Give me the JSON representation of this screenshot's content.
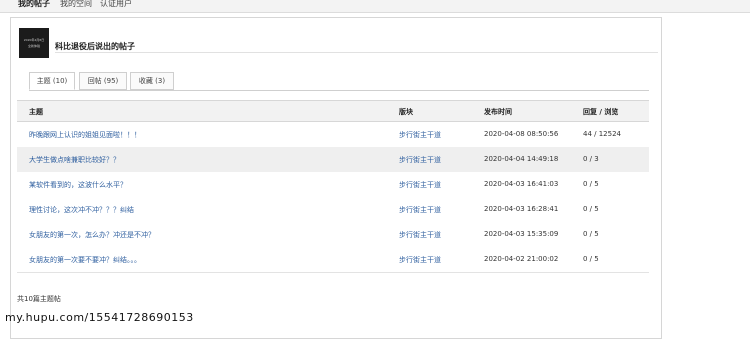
{
  "topnav": {
    "items": [
      "我的帖子",
      "我的空间",
      "认证用户"
    ]
  },
  "avatar": {
    "text_line1": "2020年4月8日",
    "text_line2": "全新体验"
  },
  "header": {
    "title": "科比退役后说出的帖子"
  },
  "tabs": [
    {
      "label": "主题 (10)"
    },
    {
      "label": "回帖 (95)"
    },
    {
      "label": "收藏 (3)"
    }
  ],
  "table": {
    "columns": [
      "主题",
      "版块",
      "发布时间",
      "回复 / 浏览"
    ],
    "rows": [
      {
        "subject": "昨晚跟网上认识的姐姐见面啦！！！",
        "forum": "步行街主干道",
        "time": "2020-04-08 08:50:56",
        "count": "44 / 12524"
      },
      {
        "subject": "大学生做点啥兼职比较好？？",
        "forum": "步行街主干道",
        "time": "2020-04-04 14:49:18",
        "count": "0 / 3"
      },
      {
        "subject": "某软件看到的，这波什么水平？",
        "forum": "步行街主干道",
        "time": "2020-04-03 16:41:03",
        "count": "0 / 5"
      },
      {
        "subject": "理性讨论，这次冲不冲？？？纠结",
        "forum": "步行街主干道",
        "time": "2020-04-03 16:28:41",
        "count": "0 / 5"
      },
      {
        "subject": "女朋友的第一次，怎么办？冲还是不冲？",
        "forum": "步行街主干道",
        "time": "2020-04-03 15:35:09",
        "count": "0 / 5"
      },
      {
        "subject": "女朋友的第一次要不要冲？纠结。。。",
        "forum": "步行街主干道",
        "time": "2020-04-02 21:00:02",
        "count": "0 / 5"
      }
    ]
  },
  "footer": {
    "summary": "共10篇主题帖"
  },
  "watermark": "my.hupu.com/15541728690153"
}
